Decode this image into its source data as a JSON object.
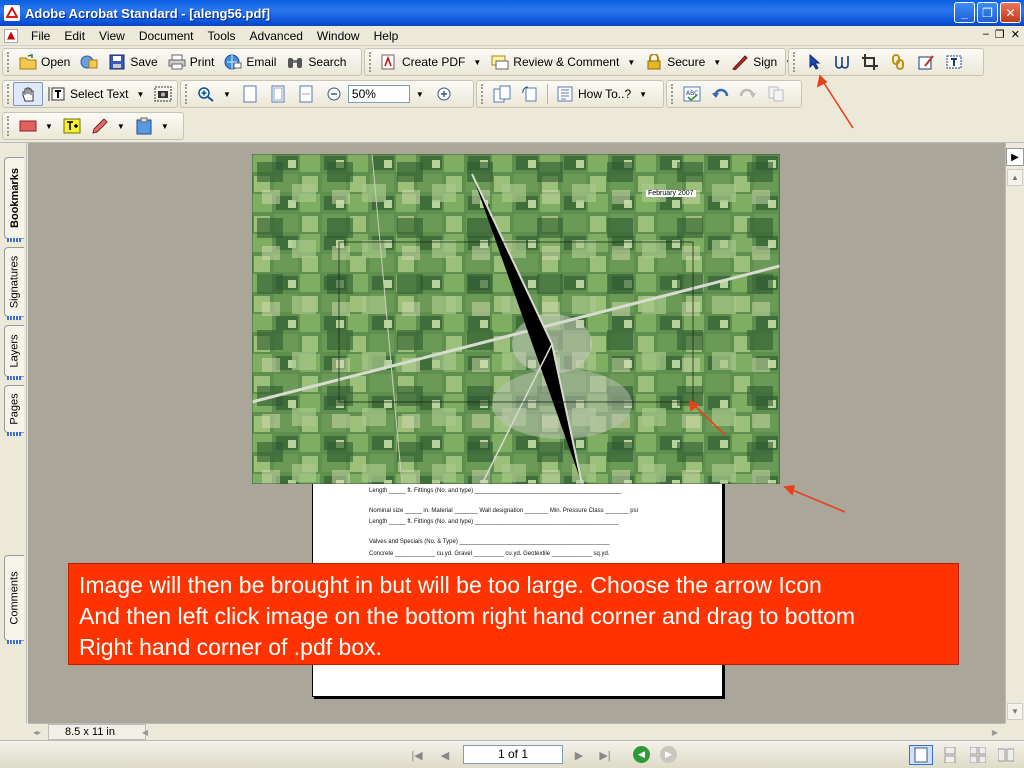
{
  "window": {
    "title": "Adobe Acrobat Standard - [aleng56.pdf]",
    "minimize": "_",
    "restore": "❐",
    "close": "✕"
  },
  "menu": {
    "items": [
      "File",
      "Edit",
      "View",
      "Document",
      "Tools",
      "Advanced",
      "Window",
      "Help"
    ],
    "mdi_min": "–",
    "mdi_restore": "❐",
    "mdi_close": "✕"
  },
  "toolbar1": {
    "open": "Open",
    "save": "Save",
    "print": "Print",
    "email": "Email",
    "search": "Search",
    "create_pdf": "Create PDF",
    "review": "Review & Comment",
    "secure": "Secure",
    "sign": "Sign"
  },
  "toolbar2": {
    "select_text": "Select Text",
    "zoom": "50%",
    "how_to": "How To..?"
  },
  "nav_tabs": [
    "Bookmarks",
    "Signatures",
    "Layers",
    "Pages",
    "Comments"
  ],
  "document": {
    "map_date": "February 2007",
    "form_lines": [
      "Length _____ ft.      Fittings (No. and type) ____________________________________________",
      "Nominal size _____ in.      Material _______      Wall designation _______      Min. Pressure Class _______ psi",
      "Length _____ ft.      Fittings (No. and type) ___________________________________________",
      "Valves and Specials (No. & Type) _____________________________________________",
      "Concrete ____________ cu.yd.      Gravel _________ cu.yd.      Geotextile ____________ sq.yd."
    ]
  },
  "callout": {
    "line1": "Image will then be brought in but will be too large.  Choose the arrow Icon",
    "line2": "And then left click image on the bottom right hand corner and drag to bottom",
    "line3": "Right hand corner of .pdf box."
  },
  "status": {
    "page_size": "8.5 x 11 in",
    "page_indicator": "1 of 1"
  },
  "colors": {
    "callout_bg": "#ff3300",
    "annotation_arrow": "#e8401a",
    "titlebar": "#0a5fe0"
  }
}
